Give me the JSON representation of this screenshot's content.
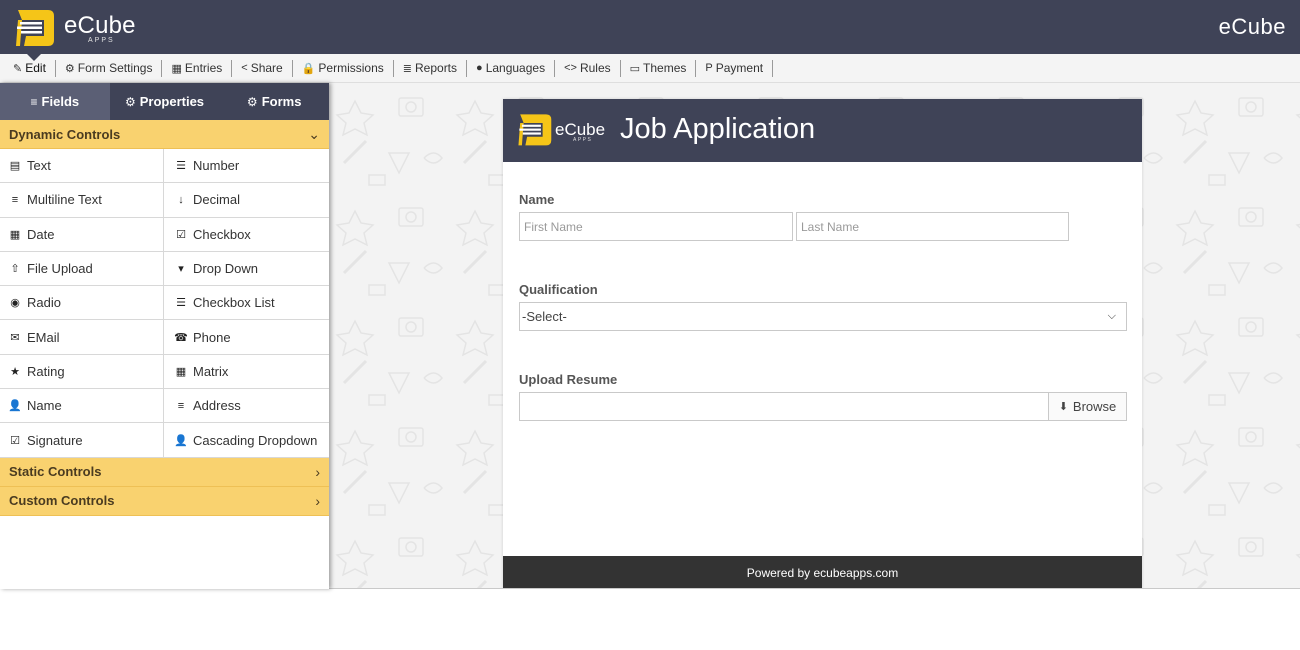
{
  "header": {
    "logo_text": "eCube",
    "logo_sub": "APPS",
    "brand_right": "eCube"
  },
  "toolbar": [
    {
      "label": "Edit",
      "icon": "edit-icon",
      "glyph": "✎"
    },
    {
      "label": "Form Settings",
      "icon": "gear-icon",
      "glyph": "⚙"
    },
    {
      "label": "Entries",
      "icon": "table-icon",
      "glyph": "▦"
    },
    {
      "label": "Share",
      "icon": "share-icon",
      "glyph": "<"
    },
    {
      "label": "Permissions",
      "icon": "lock-icon",
      "glyph": "🔒"
    },
    {
      "label": "Reports",
      "icon": "database-icon",
      "glyph": "≣"
    },
    {
      "label": "Languages",
      "icon": "globe-icon",
      "glyph": "●"
    },
    {
      "label": "Rules",
      "icon": "code-icon",
      "glyph": "<>"
    },
    {
      "label": "Themes",
      "icon": "id-card-icon",
      "glyph": "▭"
    },
    {
      "label": "Payment",
      "icon": "paypal-icon",
      "glyph": "P"
    }
  ],
  "left_tabs": [
    {
      "label": "Fields",
      "icon": "bars-icon",
      "glyph": "≡"
    },
    {
      "label": "Properties",
      "icon": "cogs-icon",
      "glyph": "⚙"
    },
    {
      "label": "Forms",
      "icon": "gear-icon",
      "glyph": "⚙"
    }
  ],
  "sections": {
    "dynamic": "Dynamic Controls",
    "static": "Static Controls",
    "custom": "Custom Controls"
  },
  "controls": [
    {
      "label": "Text",
      "icon": "file-text-icon",
      "glyph": "▤"
    },
    {
      "label": "Number",
      "icon": "list-ol-icon",
      "glyph": "☰"
    },
    {
      "label": "Multiline Text",
      "icon": "align-justify-icon",
      "glyph": "≡"
    },
    {
      "label": "Decimal",
      "icon": "sort-numeric-icon",
      "glyph": "↓"
    },
    {
      "label": "Date",
      "icon": "calendar-icon",
      "glyph": "▦"
    },
    {
      "label": "Checkbox",
      "icon": "check-square-icon",
      "glyph": "☑"
    },
    {
      "label": "File Upload",
      "icon": "upload-icon",
      "glyph": "⇧"
    },
    {
      "label": "Drop Down",
      "icon": "caret-square-down-icon",
      "glyph": "▾"
    },
    {
      "label": "Radio",
      "icon": "dot-circle-icon",
      "glyph": "◉"
    },
    {
      "label": "Checkbox List",
      "icon": "list-icon",
      "glyph": "☰"
    },
    {
      "label": "EMail",
      "icon": "envelope-icon",
      "glyph": "✉"
    },
    {
      "label": "Phone",
      "icon": "phone-square-icon",
      "glyph": "☎"
    },
    {
      "label": "Rating",
      "icon": "star-icon",
      "glyph": "★"
    },
    {
      "label": "Matrix",
      "icon": "table-icon",
      "glyph": "▦"
    },
    {
      "label": "Name",
      "icon": "user-icon",
      "glyph": "👤"
    },
    {
      "label": "Address",
      "icon": "align-justify-icon",
      "glyph": "≡"
    },
    {
      "label": "Signature",
      "icon": "check-square-icon",
      "glyph": "☑"
    },
    {
      "label": "Cascading Dropdown",
      "icon": "user-icon",
      "glyph": "👤"
    }
  ],
  "form": {
    "logo_text": "eCube",
    "logo_sub": "APPS",
    "title": "Job Application",
    "name_label": "Name",
    "first_name_placeholder": "First Name",
    "last_name_placeholder": "Last Name",
    "qualification_label": "Qualification",
    "qualification_value": "-Select-",
    "resume_label": "Upload Resume",
    "browse_label": "Browse",
    "footer": "Powered by ecubeapps.com"
  },
  "colors": {
    "header_bg": "#3f4357",
    "accent_yellow": "#f9d26f",
    "logo_yellow": "#f5c518",
    "footer_bg": "#333333"
  }
}
